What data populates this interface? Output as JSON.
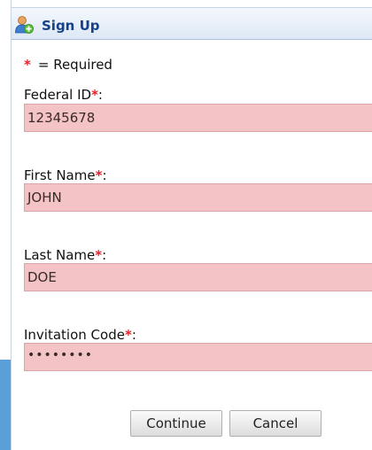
{
  "dialog": {
    "title": "Sign Up",
    "icon": "user-add-icon"
  },
  "required_note": {
    "star": "*",
    "text": "= Required"
  },
  "fields": {
    "federal_id": {
      "label": "Federal ID",
      "star": "*",
      "colon": ":",
      "value": "12345678"
    },
    "first_name": {
      "label": "First Name",
      "star": "*",
      "colon": ":",
      "value": "JOHN"
    },
    "last_name": {
      "label": "Last Name",
      "star": "*",
      "colon": ":",
      "value": "DOE"
    },
    "invitation_code": {
      "label": "Invitation Code",
      "star": "*",
      "colon": ":",
      "value": "••••••••"
    }
  },
  "buttons": {
    "continue": "Continue",
    "cancel": "Cancel"
  },
  "colors": {
    "title_text": "#15428b",
    "required_star": "#e8202a",
    "invalid_field_bg": "#f4c3c6"
  }
}
